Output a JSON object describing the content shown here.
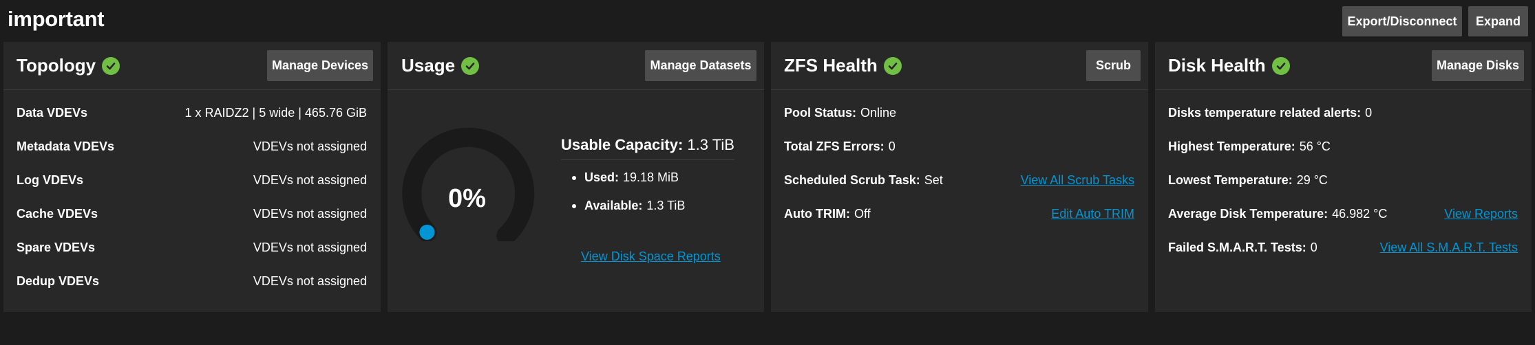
{
  "pool": {
    "name": "important",
    "export_label": "Export/Disconnect",
    "expand_label": "Expand"
  },
  "topology": {
    "title": "Topology",
    "button": "Manage Devices",
    "rows": [
      {
        "label": "Data VDEVs",
        "value": "1 x RAIDZ2 | 5 wide | 465.76 GiB"
      },
      {
        "label": "Metadata VDEVs",
        "value": "VDEVs not assigned"
      },
      {
        "label": "Log VDEVs",
        "value": "VDEVs not assigned"
      },
      {
        "label": "Cache VDEVs",
        "value": "VDEVs not assigned"
      },
      {
        "label": "Spare VDEVs",
        "value": "VDEVs not assigned"
      },
      {
        "label": "Dedup VDEVs",
        "value": "VDEVs not assigned"
      }
    ]
  },
  "usage": {
    "title": "Usage",
    "button": "Manage Datasets",
    "percent_label": "0%",
    "percent_value": 0,
    "capacity_label": "Usable Capacity:",
    "capacity_value": "1.3 TiB",
    "used_label": "Used:",
    "used_value": "19.18 MiB",
    "available_label": "Available:",
    "available_value": "1.3 TiB",
    "reports_link": "View Disk Space Reports"
  },
  "zfs": {
    "title": "ZFS Health",
    "button": "Scrub",
    "rows": [
      {
        "label": "Pool Status:",
        "value": "Online",
        "link": ""
      },
      {
        "label": "Total ZFS Errors:",
        "value": "0",
        "link": ""
      },
      {
        "label": "Scheduled Scrub Task:",
        "value": "Set",
        "link": "View All Scrub Tasks"
      },
      {
        "label": "Auto TRIM:",
        "value": "Off",
        "link": "Edit Auto TRIM"
      }
    ]
  },
  "disk": {
    "title": "Disk Health",
    "button": "Manage Disks",
    "rows": [
      {
        "label": "Disks temperature related alerts:",
        "value": "0",
        "link": ""
      },
      {
        "label": "Highest Temperature:",
        "value": "56 °C",
        "link": ""
      },
      {
        "label": "Lowest Temperature:",
        "value": "29 °C",
        "link": ""
      },
      {
        "label": "Average Disk Temperature:",
        "value": "46.982 °C",
        "link": "View Reports"
      },
      {
        "label": "Failed S.M.A.R.T. Tests:",
        "value": "0",
        "link": "View All S.M.A.R.T. Tests"
      }
    ]
  },
  "colors": {
    "background": "#1c1c1c",
    "card": "#282828",
    "button": "#4d4d4d",
    "ok_green": "#71bf44",
    "link_blue": "#0095d5",
    "gauge_track": "#1a1a1a",
    "gauge_accent": "#0095d5"
  },
  "icons": {
    "status": "check-circle-icon"
  }
}
